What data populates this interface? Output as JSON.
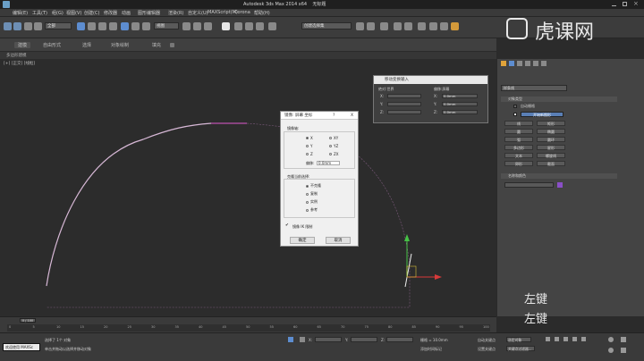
{
  "window": {
    "title": "Autodesk 3ds Max  2014 x64",
    "doc_title": "无标题"
  },
  "menu": {
    "items": [
      "编辑(E)",
      "工具(T)",
      "组(G)",
      "视图(V)",
      "创建(C)",
      "修改器",
      "动画",
      "图形编辑器",
      "渲染(R)",
      "自定义(U)",
      "MAXScript(M)",
      "Corona",
      "帮助(H)"
    ]
  },
  "toolbar": {
    "selection_filter": "全部",
    "named_set": "创建选择集",
    "view_ref": "视图"
  },
  "ribbon": {
    "tabs": [
      "建模",
      "自由形式",
      "选择",
      "对象绘制",
      "填充"
    ],
    "sub_label": "多边形建模"
  },
  "viewport": {
    "label": "[+] [正交] [线框]"
  },
  "mirror_dialog": {
    "title": "镜像: 屏幕 坐标",
    "help": "?",
    "close": "X",
    "axis_group": "镜像轴:",
    "axes": [
      "X",
      "Y",
      "Z",
      "XY",
      "YZ",
      "ZX"
    ],
    "offset_label": "偏移:",
    "offset_value": "0.0mm",
    "clone_group": "克隆当前选择:",
    "clone_options": [
      "不克隆",
      "复制",
      "实例",
      "参考"
    ],
    "ik_label": "镜像 IK 限制",
    "ok": "确定",
    "cancel": "取消"
  },
  "transform_dialog": {
    "title": "移动变换输入",
    "abs_group": "绝对:世界",
    "off_group": "偏移:屏幕",
    "abs_labels": [
      "X:",
      "Y:",
      "Z:"
    ],
    "off_labels": [
      "X:",
      "Y:",
      "Z:"
    ],
    "off_values": [
      "0.0mm",
      "0.0mm",
      "0.0mm"
    ]
  },
  "command_panel": {
    "dropdown": "样条线",
    "rollout_object_type": "对象类型",
    "autogrid": "自动栅格",
    "start_new_shape": "开始新图形",
    "buttons": [
      "线",
      "矩形",
      "圆",
      "椭圆",
      "弧",
      "圆环",
      "多边形",
      "星形",
      "文本",
      "螺旋线",
      "卵形",
      "截面"
    ],
    "rollout_name_color": "名称和颜色"
  },
  "timeline": {
    "frame_label": "0 / 100",
    "ticks": [
      "0",
      "5",
      "10",
      "15",
      "20",
      "25",
      "30",
      "35",
      "40",
      "45",
      "50",
      "55",
      "60",
      "65",
      "70",
      "75",
      "80",
      "85",
      "90",
      "95",
      "100"
    ]
  },
  "status": {
    "welcome": "欢迎使用 MAXSc",
    "selected": "选择了 1个 对象",
    "hint": "单击并拖动以选择并移动对象",
    "x_label": "X:",
    "y_label": "Y:",
    "z_label": "Z:",
    "grid": "栅格 = 10.0mm",
    "autokey": "自动关键点",
    "selected_obj": "选定对象",
    "setkey": "设置关键点",
    "keyfilter": "关键点过滤器...",
    "addtime": "添加时间标记"
  },
  "watermark": {
    "brand": "虎课网",
    "left_key_1": "左键",
    "left_key_2": "左键"
  }
}
